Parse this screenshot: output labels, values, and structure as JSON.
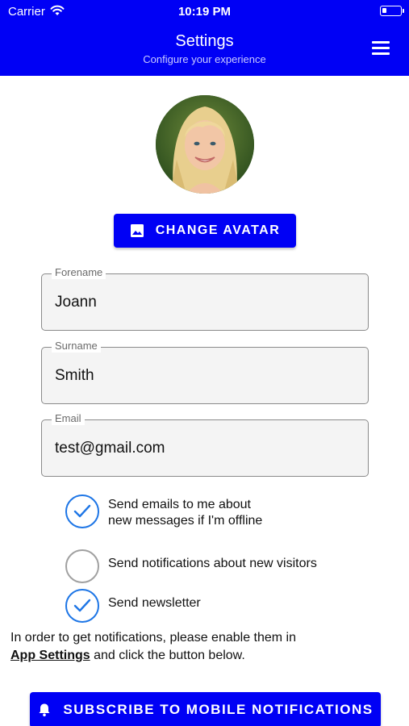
{
  "status_bar": {
    "carrier": "Carrier",
    "time": "10:19 PM"
  },
  "header": {
    "title": "Settings",
    "subtitle": "Configure your experience",
    "menu_icon": "hamburger-menu-icon",
    "background_color": "#0000f5"
  },
  "avatar": {
    "button_label": "CHANGE AVATAR",
    "button_icon": "image-icon"
  },
  "form": {
    "forename": {
      "label": "Forename",
      "value": "Joann"
    },
    "surname": {
      "label": "Surname",
      "value": "Smith"
    },
    "email": {
      "label": "Email",
      "value": "test@gmail.com"
    }
  },
  "checkboxes": [
    {
      "line1": "Send emails to me about",
      "line2": "new messages if I'm offline",
      "checked": true
    },
    {
      "label": "Send notifications about new visitors",
      "checked": false
    },
    {
      "label": "Send newsletter",
      "checked": true
    }
  ],
  "info": {
    "text_before": "In order to get notifications, please enable them in",
    "link_text": "App Settings",
    "text_after": " and click the button below."
  },
  "subscribe_button": {
    "label": "SUBSCRIBE TO MOBILE NOTIFICATIONS",
    "icon": "bell-icon"
  },
  "colors": {
    "primary": "#0000f5",
    "check_accent": "#1e76e6",
    "check_off": "#a0a0a0"
  }
}
